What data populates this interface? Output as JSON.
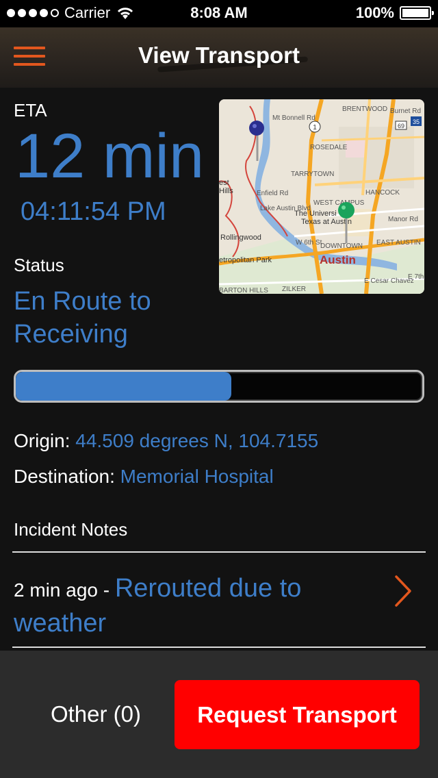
{
  "status_bar": {
    "carrier": "Carrier",
    "time": "8:08 AM",
    "battery": "100%",
    "signal_icon": "signal-dots-icon",
    "wifi_icon": "wifi-icon",
    "battery_icon": "battery-icon",
    "signal_level": 4
  },
  "nav": {
    "title": "View Transport",
    "menu_icon": "hamburger-menu-icon"
  },
  "eta": {
    "label": "ETA",
    "value": "12 min",
    "time": "04:11:54 PM"
  },
  "status": {
    "label": "Status",
    "value": "En Route to Receiving",
    "progress_fraction": 0.53
  },
  "map": {
    "labels": {
      "brentwood": "BRENTWOOD",
      "rosedale": "ROSEDALE",
      "tarrytown": "TARRYTOWN",
      "hancock": "HANCOCK",
      "west_campus": "WEST CAMPUS",
      "university": "The Universi",
      "texas_at_austin": "Texas at Austin",
      "manor": "Manor Rd",
      "rollingwood": "Rollingwood",
      "w6th": "W 6th St",
      "downtown": "DOWNTOWN",
      "east_austin": "EAST AUSTIN",
      "austin": "Austin",
      "metropolitan": "etropolitan Park",
      "barton_hills": "BARTON HILLS",
      "zilker": "ZILKER",
      "cesar": "E Cesar Chavez",
      "e7th": "E 7th S",
      "enfield": "Enfield Rd",
      "lake_austin": "Lake Austin Blvd",
      "est": "est",
      "hills": "Hills",
      "bonnell": "Mt Bonnell Rd",
      "burnet": "Burnet Rd",
      "rt1": "1",
      "rt35": "35",
      "rt69": "69"
    },
    "pin_origin_color": "#2b2f8f",
    "pin_destination_color": "#1aa35c",
    "marker_icon": "map-pin-icon"
  },
  "origin": {
    "label": "Origin:",
    "value": "44.509 degrees N, 104.7155"
  },
  "destination": {
    "label": "Destination:",
    "value": "Memorial Hospital"
  },
  "notes": {
    "label": "Incident Notes",
    "items": [
      {
        "ago": "2 min ago",
        "separator": " - ",
        "message": "Rerouted due to weather"
      }
    ]
  },
  "actions": {
    "other": "Other (0)",
    "request": "Request Transport"
  },
  "colors": {
    "accent_blue": "#3e7ec9",
    "accent_orange": "#e2571e",
    "request_red": "#ff0000"
  }
}
